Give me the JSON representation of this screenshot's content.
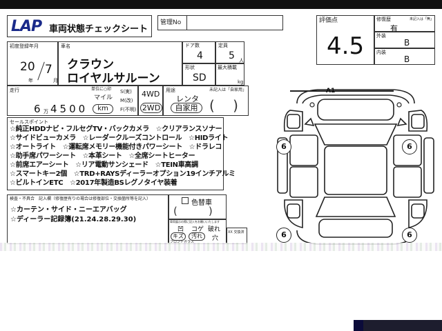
{
  "header": {
    "logo_text": "LAP",
    "sheet_title": "車両状態チェックシート",
    "mgmt_no_label": "管理No"
  },
  "registration": {
    "label": "初度登録年月",
    "year": "20",
    "year_unit": "年",
    "month": "7",
    "month_unit": "月"
  },
  "car_name": {
    "label": "車名",
    "line1": "クラウン",
    "line2": "ロイヤルサルーン"
  },
  "doors": {
    "label": "ドア数",
    "value": "4"
  },
  "capacity": {
    "label": "定員",
    "value": "5",
    "unit": "人"
  },
  "body_shape": {
    "label": "形状",
    "value": "SD"
  },
  "max_load": {
    "label": "最大積載",
    "unit": "kg"
  },
  "mileage": {
    "label": "走行",
    "digit1": "6",
    "unit_man": "万",
    "digits_rest": "4500",
    "caption": "単位に○印",
    "unit_mile": "マイル",
    "unit_km": "km",
    "status_s": "S(実)",
    "status_m": "M(改)",
    "status_fumei": "F(不明)"
  },
  "drive": {
    "opt1": "4WD",
    "opt2": "2WD"
  },
  "usage": {
    "label": "用途",
    "rental": "レンタ",
    "private": "自家用",
    "note_label": "未記入は「自家用」"
  },
  "score": {
    "label": "評価点",
    "value": "4.5"
  },
  "history": {
    "label": "修復歴",
    "value": "有",
    "note": "未記入は「無」"
  },
  "exterior": {
    "label": "外装",
    "value": "B"
  },
  "interior": {
    "label": "内装",
    "value": "B"
  },
  "sales_points": {
    "label": "セールスポイント",
    "lines": [
      "☆純正HDDナビ・フルセグTV・バックカメラ　☆クリアランスソナー",
      "☆サイドビューカメラ　☆レーダークルーズコントロール　☆HIDライト",
      "☆オートライト　☆運転席メモリー機能付きパワーシート　☆ドラレコ",
      "☆助手席パワーシート　☆本革シート　☆全席シートヒーター",
      "☆前席エアーシート　☆リア電動サンシェード　☆TEIN車高調",
      "☆スマートキー2個　☆TRD+RAYSディーラーオプション19インチアルミ",
      "☆ビルトインETC　☆2017年製造BSレグノタイヤ装着"
    ]
  },
  "inspection": {
    "label": "検査・不具合　記入欄（修復歴有りの場合は修復部位・交換箇所等を記入）",
    "lines": [
      "☆カーテン・サイド・ニーエアバッグ",
      "☆ディーラー記録簿(21.24.28.29.30)"
    ]
  },
  "color_change": {
    "label": "色替車"
  },
  "defect_legend": {
    "note": "車両展示の際に記入をお願いいたします",
    "dent": "凹",
    "koge": "コゲ",
    "break": "破れ",
    "scratch": "キズ",
    "stain": "汚れ",
    "hole": "穴",
    "xx_label": "XX 交換済",
    "front_glass": "フロントガラス"
  },
  "diagram": {
    "a1_label": "A1",
    "tire_marks": [
      "6",
      "6",
      "6",
      "6"
    ]
  }
}
